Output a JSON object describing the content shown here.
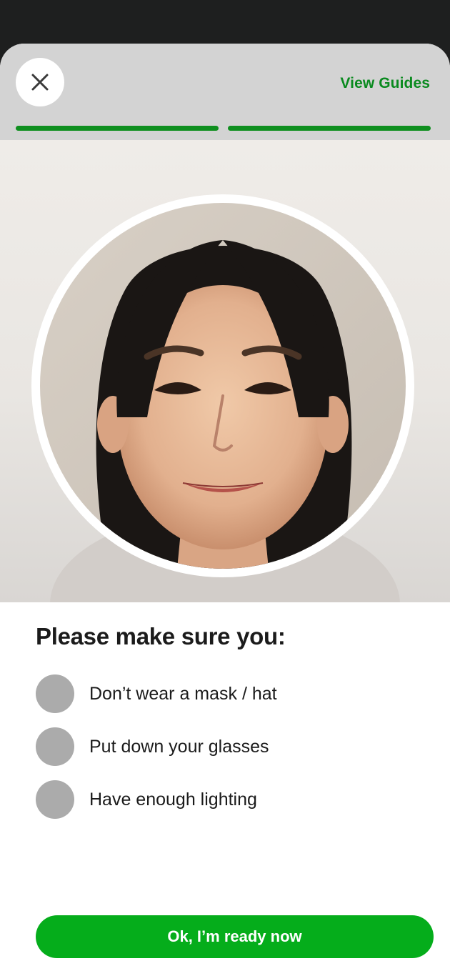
{
  "header": {
    "close_icon": "close-icon",
    "view_guides_label": "View Guides",
    "progress": {
      "current_step": 2,
      "total_steps": 2
    }
  },
  "camera": {
    "subject": "face-photo"
  },
  "checklist": {
    "title": "Please make sure you:",
    "items": [
      {
        "label": "Don’t wear a mask / hat"
      },
      {
        "label": "Put down your glasses"
      },
      {
        "label": "Have enough lighting"
      }
    ]
  },
  "primary_button": {
    "label": "Ok, I’m ready now"
  },
  "colors": {
    "accent": "#05ad1b",
    "link": "#0a8a1f",
    "progress": "#0f8f1f",
    "header_bg": "#d3d3d3",
    "checkbox_idle": "#ababab"
  }
}
